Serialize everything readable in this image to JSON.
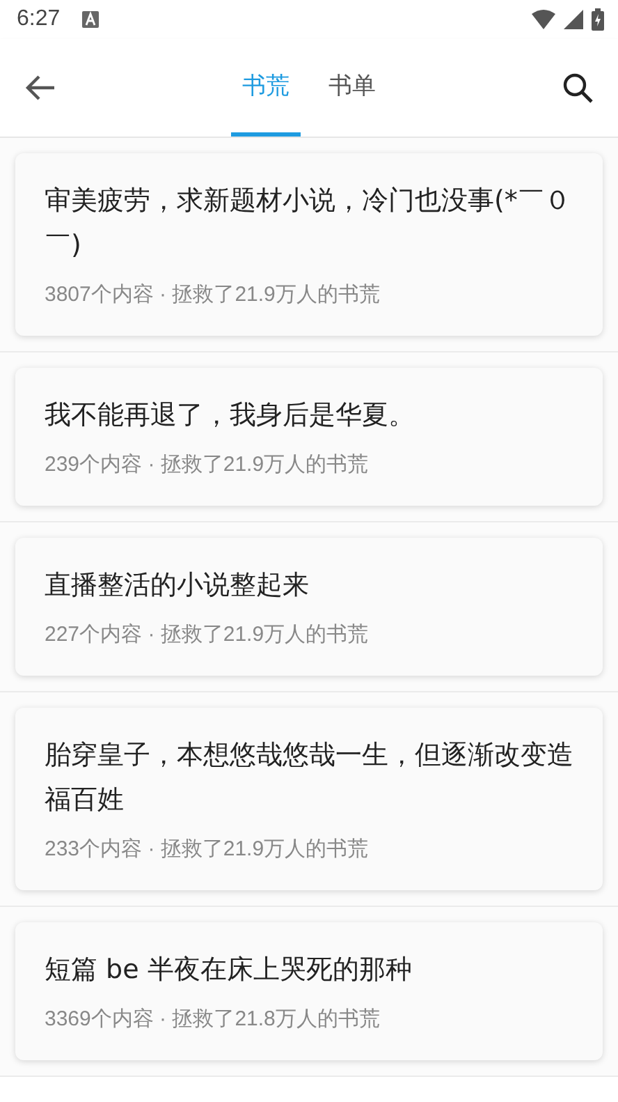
{
  "status_bar": {
    "time": "6:27"
  },
  "toolbar": {
    "tabs": [
      {
        "label": "书荒",
        "selected": true
      },
      {
        "label": "书单",
        "selected": false
      }
    ]
  },
  "posts": [
    {
      "title": "审美疲劳，求新题材小说，冷门也没事(*￣０￣)",
      "meta": "3807个内容 · 拯救了21.9万人的书荒"
    },
    {
      "title": "我不能再退了，我身后是华夏。",
      "meta": "239个内容 · 拯救了21.9万人的书荒"
    },
    {
      "title": "直播整活的小说整起来",
      "meta": "227个内容 · 拯救了21.9万人的书荒"
    },
    {
      "title": "胎穿皇子，本想悠哉悠哉一生，但逐渐改变造福百姓",
      "meta": "233个内容 · 拯救了21.9万人的书荒"
    },
    {
      "title": "短篇 be 半夜在床上哭死的那种",
      "meta": "3369个内容 · 拯救了21.8万人的书荒"
    }
  ]
}
